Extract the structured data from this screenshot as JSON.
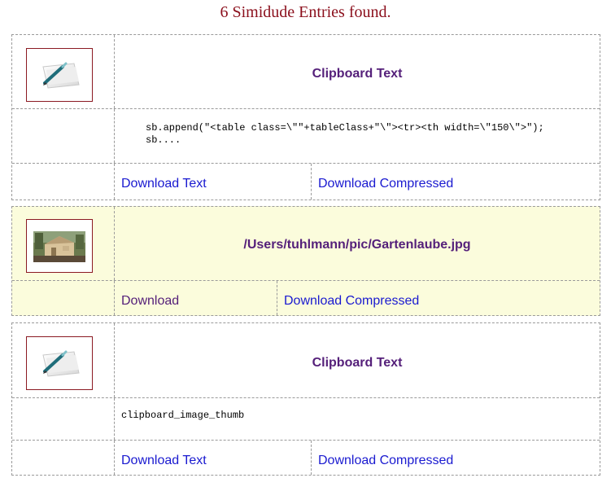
{
  "heading": "6 Simidude Entries found.",
  "entries": [
    {
      "icon": "clipboard-pen-icon",
      "title": "Clipboard Text",
      "snippet_line1": "sb.append(\"<table class=\\\"\"+tableClass+\"\\\"><tr><th width=\\\"150\\\">\");",
      "snippet_line2": "sb....",
      "download_label": "Download Text",
      "compressed_label": "Download Compressed"
    },
    {
      "icon": "garden-shed-photo",
      "title": "/Users/tuhlmann/pic/Gartenlaube.jpg",
      "download_label": "Download",
      "compressed_label": "Download Compressed"
    },
    {
      "icon": "clipboard-pen-icon",
      "title": "Clipboard Text",
      "snippet_line1": "clipboard_image_thumb",
      "download_label": "Download Text",
      "compressed_label": "Download Compressed"
    }
  ],
  "colors": {
    "heading": "#8b0f1c",
    "title": "#55207a",
    "link": "#1a1ad0",
    "visited_link": "#55207a",
    "highlight_row": "#fbfcdc",
    "thumb_border": "#8b1a22"
  }
}
